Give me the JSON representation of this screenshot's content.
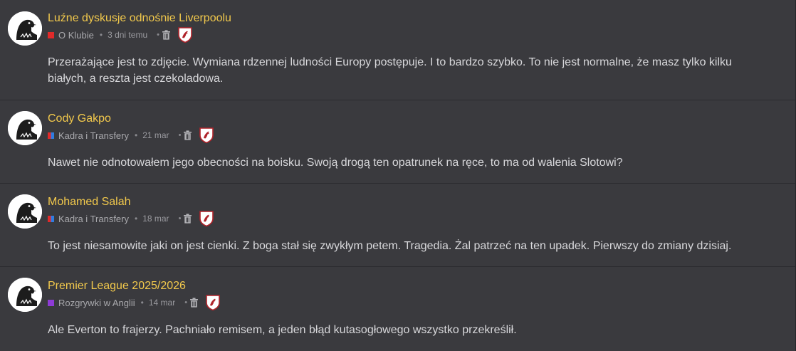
{
  "colors": {
    "background": "#3a3a3e",
    "title": "#f2c94c",
    "text": "#d8d8db",
    "meta": "#a7a7ab",
    "badge_red": "#b0232a"
  },
  "posts": [
    {
      "title": "Luźne dyskusje odnośnie Liverpoolu",
      "category": "O Klubie",
      "category_colors": [
        "#e02a2a"
      ],
      "date": "3 dni temu",
      "text": "Przerażające jest to zdjęcie. Wymiana rdzennej ludności Europy postępuje. I to bardzo szybko. To nie jest normalne, że masz tylko kilku białych, a reszta jest czekoladowa.",
      "avatar_icon": "bird-avatar-icon",
      "delete_icon": "trash-icon",
      "badge_icon": "liverpool-crest-icon"
    },
    {
      "title": "Cody Gakpo",
      "category": "Kadra i Transfery",
      "category_colors": [
        "#e02a2a",
        "#2f7de1"
      ],
      "date": "21 mar",
      "text": "Nawet nie odnotowałem jego obecności na boisku. Swoją drogą ten opatrunek na ręce, to ma od walenia Slotowi?",
      "avatar_icon": "bird-avatar-icon",
      "delete_icon": "trash-icon",
      "badge_icon": "liverpool-crest-icon"
    },
    {
      "title": "Mohamed Salah",
      "category": "Kadra i Transfery",
      "category_colors": [
        "#e02a2a",
        "#2f7de1"
      ],
      "date": "18 mar",
      "text": "To jest niesamowite jaki on jest cienki. Z boga stał się zwykłym petem. Tragedia. Żal patrzeć na ten upadek. Pierwszy do zmiany dzisiaj.",
      "avatar_icon": "bird-avatar-icon",
      "delete_icon": "trash-icon",
      "badge_icon": "liverpool-crest-icon"
    },
    {
      "title": "Premier League 2025/2026",
      "category": "Rozgrywki w Anglii",
      "category_colors": [
        "#8e3bd6"
      ],
      "date": "14 mar",
      "text": "Ale Everton to frajerzy. Pachniało remisem, a jeden błąd kutasogłowego wszystko przekreślił.",
      "avatar_icon": "bird-avatar-icon",
      "delete_icon": "trash-icon",
      "badge_icon": "liverpool-crest-icon"
    }
  ]
}
